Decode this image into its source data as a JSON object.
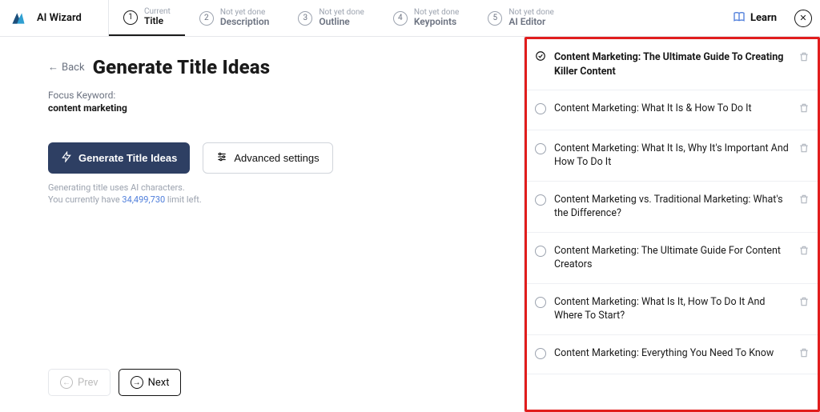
{
  "brand": "AI Wizard",
  "steps": [
    {
      "num": "1",
      "status": "Current",
      "name": "Title",
      "current": true
    },
    {
      "num": "2",
      "status": "Not yet done",
      "name": "Description",
      "current": false
    },
    {
      "num": "3",
      "status": "Not yet done",
      "name": "Outline",
      "current": false
    },
    {
      "num": "4",
      "status": "Not yet done",
      "name": "Keypoints",
      "current": false
    },
    {
      "num": "5",
      "status": "Not yet done",
      "name": "AI Editor",
      "current": false
    }
  ],
  "learn_label": "Learn",
  "back_label": "Back",
  "page_title": "Generate Title Ideas",
  "focus_keyword_label": "Focus Keyword:",
  "focus_keyword_value": "content marketing",
  "generate_button": "Generate Title Ideas",
  "advanced_button": "Advanced settings",
  "hint_line1": "Generating title uses AI characters.",
  "hint_line2_pre": "You currently have ",
  "hint_count": "34,499,730",
  "hint_line2_post": " limit left.",
  "prev_label": "Prev",
  "next_label": "Next",
  "results": [
    {
      "selected": true,
      "title": "Content Marketing: The Ultimate Guide To Creating Killer Content"
    },
    {
      "selected": false,
      "title": "Content Marketing: What It Is & How To Do It"
    },
    {
      "selected": false,
      "title": "Content Marketing: What It Is, Why It's Important And How To Do It"
    },
    {
      "selected": false,
      "title": "Content Marketing vs. Traditional Marketing: What's the Difference?"
    },
    {
      "selected": false,
      "title": "Content Marketing: The Ultimate Guide For Content Creators"
    },
    {
      "selected": false,
      "title": "Content Marketing: What Is It, How To Do It And Where To Start?"
    },
    {
      "selected": false,
      "title": "Content Marketing: Everything You Need To Know"
    }
  ]
}
